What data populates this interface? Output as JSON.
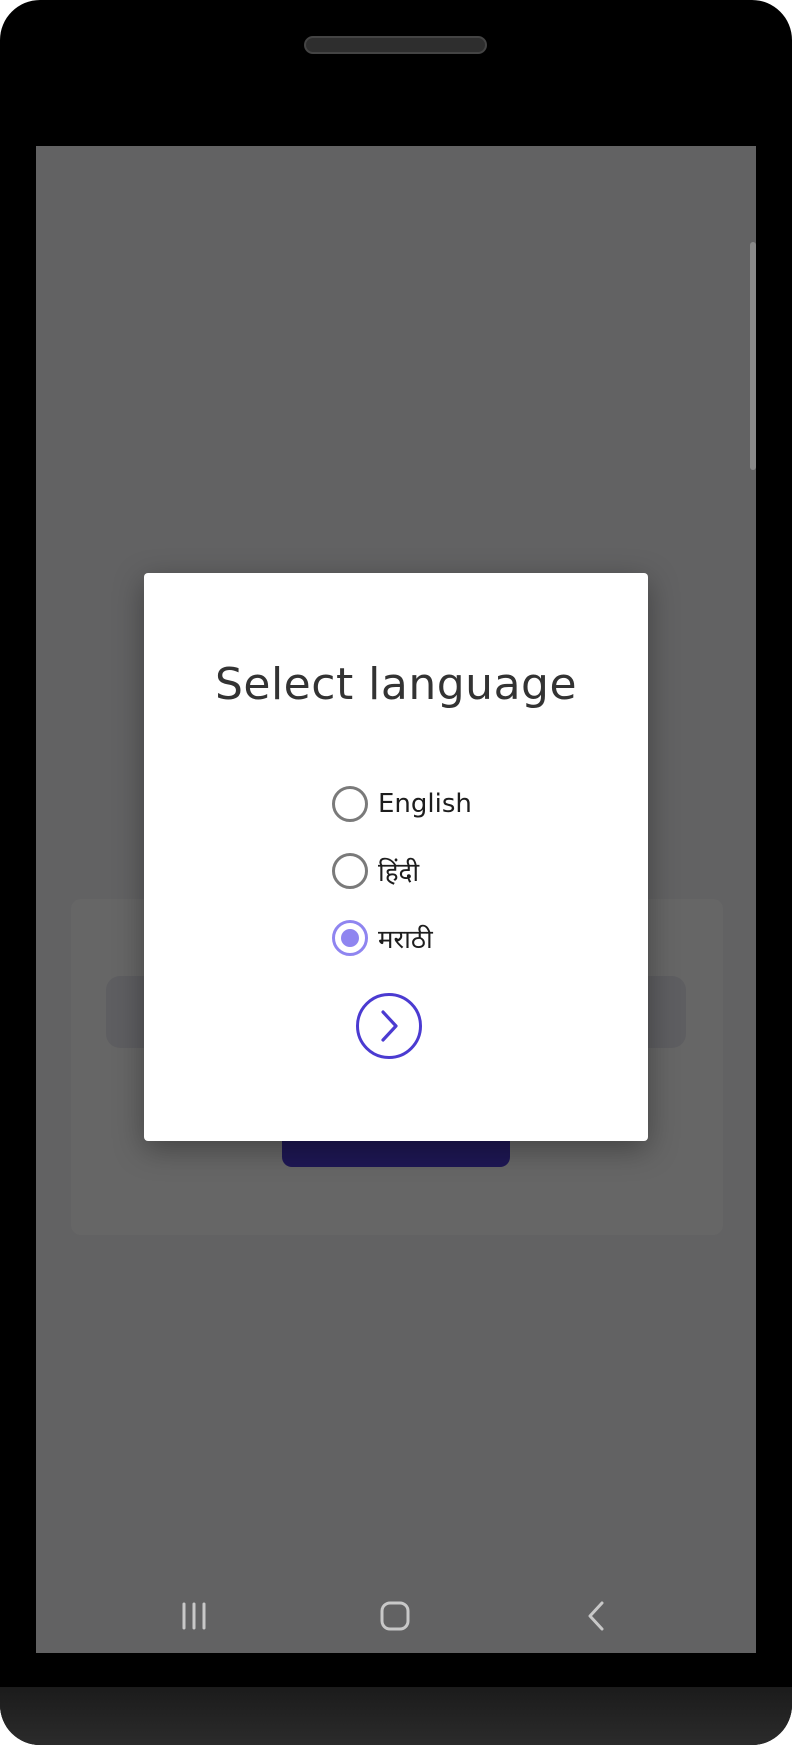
{
  "dialog": {
    "title": "Select language",
    "options": [
      {
        "label": "English",
        "selected": false
      },
      {
        "label": "हिंदी",
        "selected": false
      },
      {
        "label": "मराठी",
        "selected": true
      }
    ],
    "next_icon": "chevron-right-circle-icon"
  },
  "navbar": {
    "recents_icon": "recents-icon",
    "home_icon": "home-icon",
    "back_icon": "back-icon"
  },
  "colors": {
    "accent": "#4b3bd1",
    "radio_selected": "#8f85f0",
    "scrim": "rgba(0,0,0,0.60)"
  }
}
